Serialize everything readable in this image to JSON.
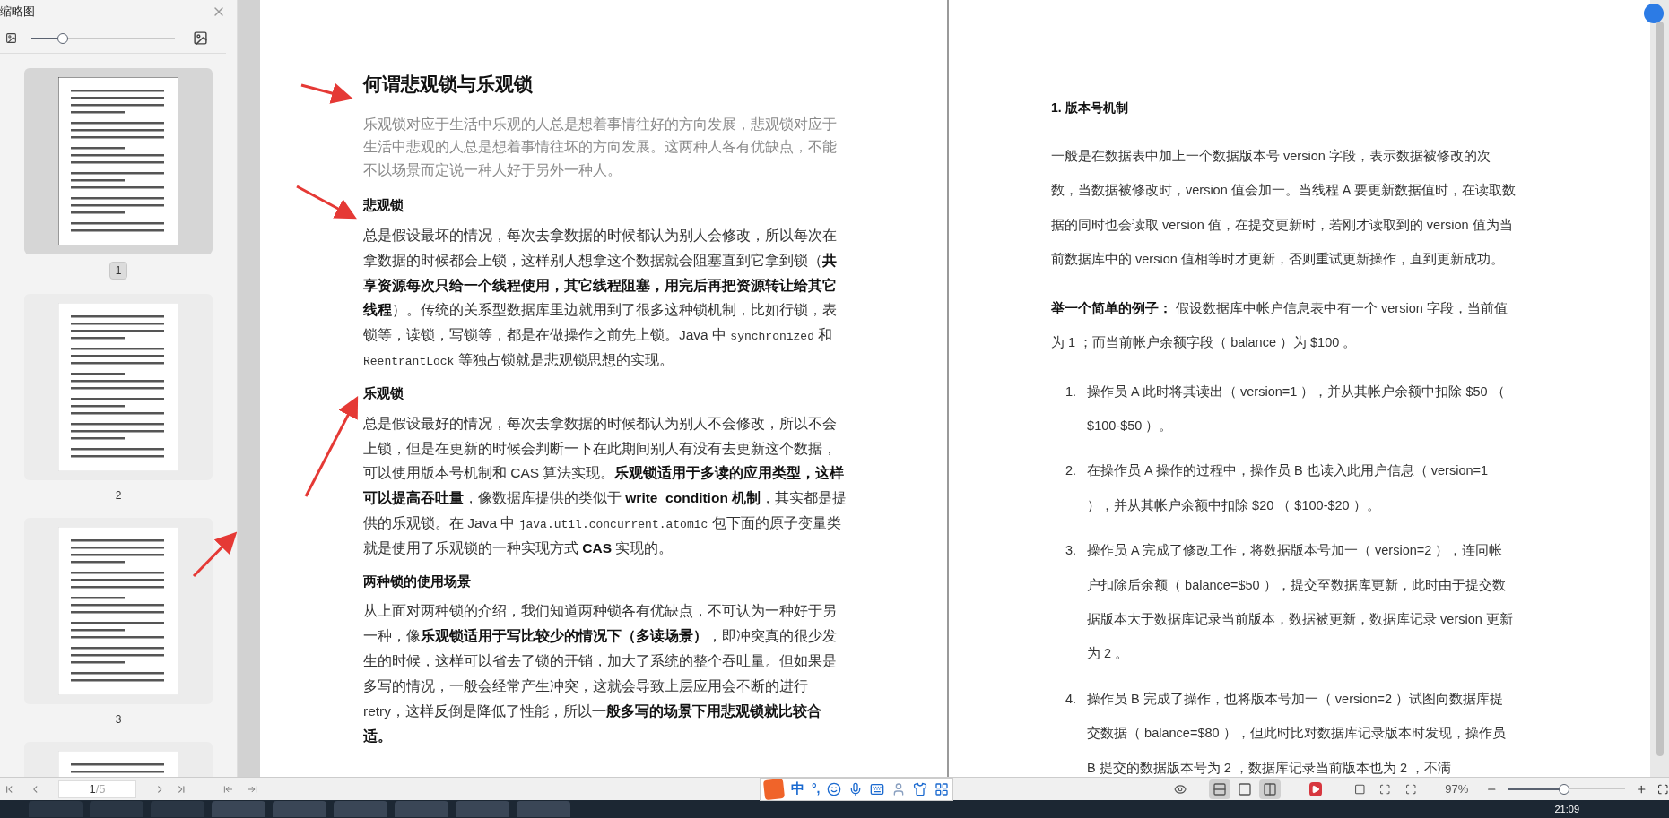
{
  "sidebar": {
    "title": "缩略图",
    "slider": {
      "level": 0.22
    },
    "thumbnails": [
      {
        "label": "1",
        "selected": true
      },
      {
        "label": "2",
        "selected": false
      },
      {
        "label": "3",
        "selected": false
      },
      {
        "selected": false
      }
    ]
  },
  "left_page": [
    {
      "kind": "title",
      "segments": [
        {
          "kind": "bold",
          "text": "何谓悲观锁与乐观锁"
        }
      ]
    },
    {
      "kind": "lead",
      "segments": [
        {
          "kind": "normal",
          "text": "乐观锁对应于生活中乐观的人总是想着事情往好的方向发展，悲观锁对应于生活中悲观的人总是想着事情往坏的方向发展。这两种人各有优缺点，不能不以场景而定说一种人好于另外一种人。"
        }
      ]
    },
    {
      "kind": "heading",
      "segments": [
        {
          "kind": "bold",
          "text": "悲观锁"
        }
      ]
    },
    {
      "kind": "paragraph",
      "segments": [
        {
          "kind": "normal",
          "text": "总是假设最坏的情况，每次去拿数据的时候都认为别人会修改，所以每次在拿数据的时候都会上锁，这样别人想拿这个数据就会阻塞直到它拿到锁（"
        },
        {
          "kind": "bold",
          "text": "共享资源每次只给一个线程使用，其它线程阻塞，用完后再把资源转让给其它线程"
        },
        {
          "kind": "normal",
          "text": "）。传统的关系型数据库里边就用到了很多这种锁机制，比如行锁，表锁等，读锁，写锁等，都是在做操作之前先上锁。Java 中 "
        },
        {
          "kind": "code",
          "text": "synchronized"
        },
        {
          "kind": "normal",
          "text": " 和 "
        },
        {
          "kind": "code",
          "text": "ReentrantLock"
        },
        {
          "kind": "normal",
          "text": " 等独占锁就是悲观锁思想的实现。"
        }
      ]
    },
    {
      "kind": "heading",
      "segments": [
        {
          "kind": "bold",
          "text": "乐观锁"
        }
      ]
    },
    {
      "kind": "paragraph",
      "segments": [
        {
          "kind": "normal",
          "text": "总是假设最好的情况，每次去拿数据的时候都认为别人不会修改，所以不会上锁，但是在更新的时候会判断一下在此期间别人有没有去更新这个数据，可以使用版本号机制和 CAS 算法实现。"
        },
        {
          "kind": "bold",
          "text": "乐观锁适用于多读的应用类型，这样可以提高吞吐量"
        },
        {
          "kind": "normal",
          "text": "，像数据库提供的类似于 "
        },
        {
          "kind": "bold",
          "text": "write_condition 机制"
        },
        {
          "kind": "normal",
          "text": "，其实都是提供的乐观锁。在 Java 中 "
        },
        {
          "kind": "code",
          "text": "java.util.concurrent.atomic"
        },
        {
          "kind": "normal",
          "text": " 包下面的原子变量类就是使用了乐观锁的一种实现方式 "
        },
        {
          "kind": "bold",
          "text": "CAS"
        },
        {
          "kind": "normal",
          "text": " 实现的。"
        }
      ]
    },
    {
      "kind": "heading",
      "segments": [
        {
          "kind": "bold",
          "text": "两种锁的使用场景"
        }
      ]
    },
    {
      "kind": "paragraph",
      "segments": [
        {
          "kind": "normal",
          "text": "从上面对两种锁的介绍，我们知道两种锁各有优缺点，不可认为一种好于另一种，像"
        },
        {
          "kind": "bold",
          "text": "乐观锁适用于写比较少的情况下（多读场景）"
        },
        {
          "kind": "normal",
          "text": "，即冲突真的很少发生的时候，这样可以省去了锁的开销，加大了系统的整个吞吐量。但如果是多写的情况，一般会经常产生冲突，这就会导致上层应用会不断的进行 retry，这样反倒是降低了性能，所以"
        },
        {
          "kind": "bold",
          "text": "一般多写的场景下用悲观锁就比较合适。"
        }
      ]
    }
  ],
  "right_page": [
    {
      "kind": "heading",
      "segments": [
        {
          "kind": "bold",
          "text": "1. 版本号机制"
        }
      ]
    },
    {
      "kind": "paragraph",
      "segments": [
        {
          "kind": "normal",
          "text": "一般是在数据表中加上一个数据版本号 version 字段，表示数据被修改的次数，当数据被修改时，version 值会加一。当线程 A 要更新数据值时，在读取数据的同时也会读取 version 值，在提交更新时，若刚才读取到的 version 值为当前数据库中的 version 值相等时才更新，否则重试更新操作，直到更新成功。"
        }
      ]
    },
    {
      "kind": "paragraph",
      "segments": [
        {
          "kind": "bold",
          "text": "举一个简单的例子："
        },
        {
          "kind": "normal",
          "text": " 假设数据库中帐户信息表中有一个 version 字段，当前值为 1 ；而当前帐户余额字段（ balance ）为 $100 。"
        }
      ]
    },
    {
      "kind": "item",
      "number": "1.",
      "segments": [
        {
          "kind": "normal",
          "text": "操作员 A 此时将其读出（ version=1 ），并从其帐户余额中扣除 $50 （ $100-$50 ）。"
        }
      ]
    },
    {
      "kind": "item",
      "number": "2.",
      "segments": [
        {
          "kind": "normal",
          "text": "在操作员 A 操作的过程中，操作员 B 也读入此用户信息（ version=1 ），并从其帐户余额中扣除 $20 （ $100-$20 ）。"
        }
      ]
    },
    {
      "kind": "item",
      "number": "3.",
      "segments": [
        {
          "kind": "normal",
          "text": "操作员 A 完成了修改工作，将数据版本号加一（ version=2 ），连同帐户扣除后余额（ balance=$50 ），提交至数据库更新，此时由于提交数据版本大于数据库记录当前版本，数据被更新，数据库记录 version 更新为 2 。"
        }
      ]
    },
    {
      "kind": "item",
      "number": "4.",
      "segments": [
        {
          "kind": "normal",
          "text": "操作员 B 完成了操作，也将版本号加一（ version=2 ）试图向数据库提交数据（ balance=$80 ），但此时比对数据库记录版本时发现，操作员 B 提交的数据版本号为 2 ，数据库记录当前版本也为 2 ，不满"
        }
      ]
    }
  ],
  "toolbar": {
    "page_current": "1",
    "page_total": "/5",
    "view_modes": [
      {
        "kind": "continuous",
        "selected": true
      },
      {
        "kind": "single",
        "selected": false
      },
      {
        "kind": "double",
        "selected": true
      }
    ],
    "zoom": "97%",
    "zoom_slider": {
      "level": 0.48
    }
  },
  "ime": {
    "mode": "中",
    "punctuation": "°,"
  },
  "taskbar": {
    "time": "21:09"
  }
}
